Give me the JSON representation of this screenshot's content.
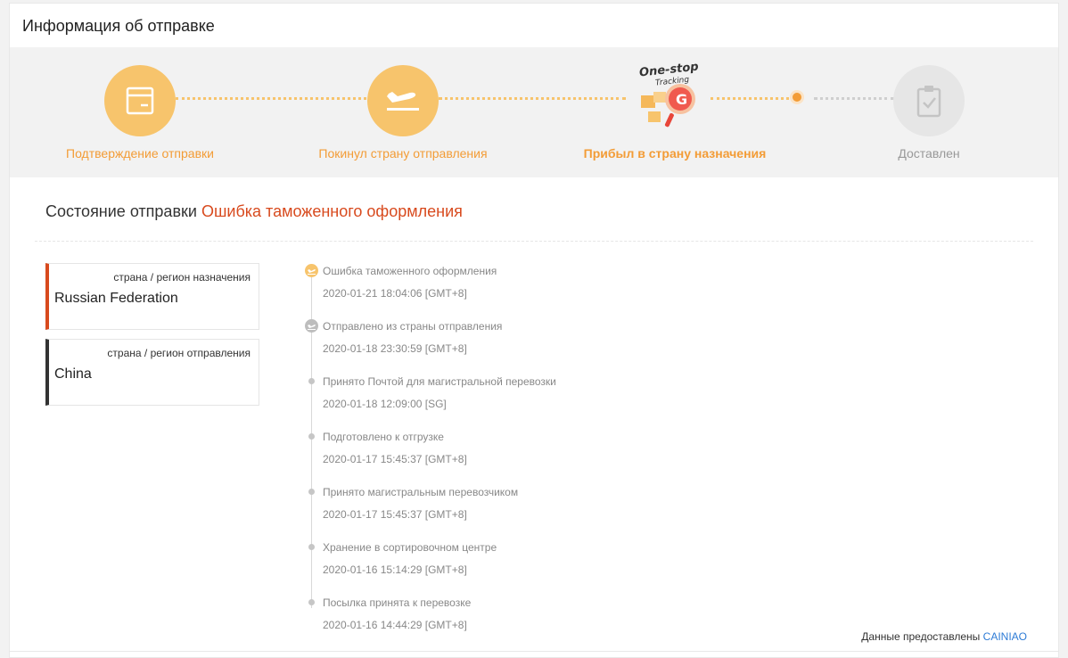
{
  "header": {
    "title": "Информация об отправке"
  },
  "colors": {
    "accent": "#f39c36",
    "accent_light": "#f7c46c",
    "error": "#d84a1e",
    "link": "#2d7bd6",
    "inactive": "#999999"
  },
  "steps": [
    {
      "label": "Подтверждение отправки",
      "icon": "box-icon",
      "state": "done"
    },
    {
      "label": "Покинул страну отправления",
      "icon": "airplane-departure-icon",
      "state": "done"
    },
    {
      "label": "Прибыл в страну назначения",
      "icon": "one-stop-tracking-logo",
      "state": "current"
    },
    {
      "label": "Доставлен",
      "icon": "clipboard-check-icon",
      "state": "pending"
    }
  ],
  "logo": {
    "line1": "One-stop",
    "line2": "Tracking",
    "letter": "G"
  },
  "status": {
    "label": "Состояние отправки",
    "value": "Ошибка таможенного оформления"
  },
  "regions": {
    "destination": {
      "label": "страна / регион назначения",
      "value": "Russian Federation"
    },
    "origin": {
      "label": "страна / регион отправления",
      "value": "China"
    }
  },
  "timeline": [
    {
      "title": "Ошибка таможенного оформления",
      "time": "2020-01-21 18:04:06 [GMT+8]",
      "icon": "customs-icon"
    },
    {
      "title": "Отправлено из страны отправления",
      "time": "2020-01-18 23:30:59 [GMT+8]",
      "icon": "airplane-icon"
    },
    {
      "title": "Принято Почтой для магистральной перевозки",
      "time": "2020-01-18 12:09:00 [SG]",
      "icon": "dot-icon"
    },
    {
      "title": "Подготовлено к отгрузке",
      "time": "2020-01-17 15:45:37 [GMT+8]",
      "icon": "dot-icon"
    },
    {
      "title": "Принято магистральным перевозчиком",
      "time": "2020-01-17 15:45:37 [GMT+8]",
      "icon": "dot-icon"
    },
    {
      "title": "Хранение в сортировочном центре",
      "time": "2020-01-16 15:14:29 [GMT+8]",
      "icon": "dot-icon"
    },
    {
      "title": "Посылка принята к перевозке",
      "time": "2020-01-16 14:44:29 [GMT+8]",
      "icon": "dot-icon"
    }
  ],
  "footer": {
    "provided_label": "Данные предоставлены",
    "provider": "CAINIAO"
  }
}
